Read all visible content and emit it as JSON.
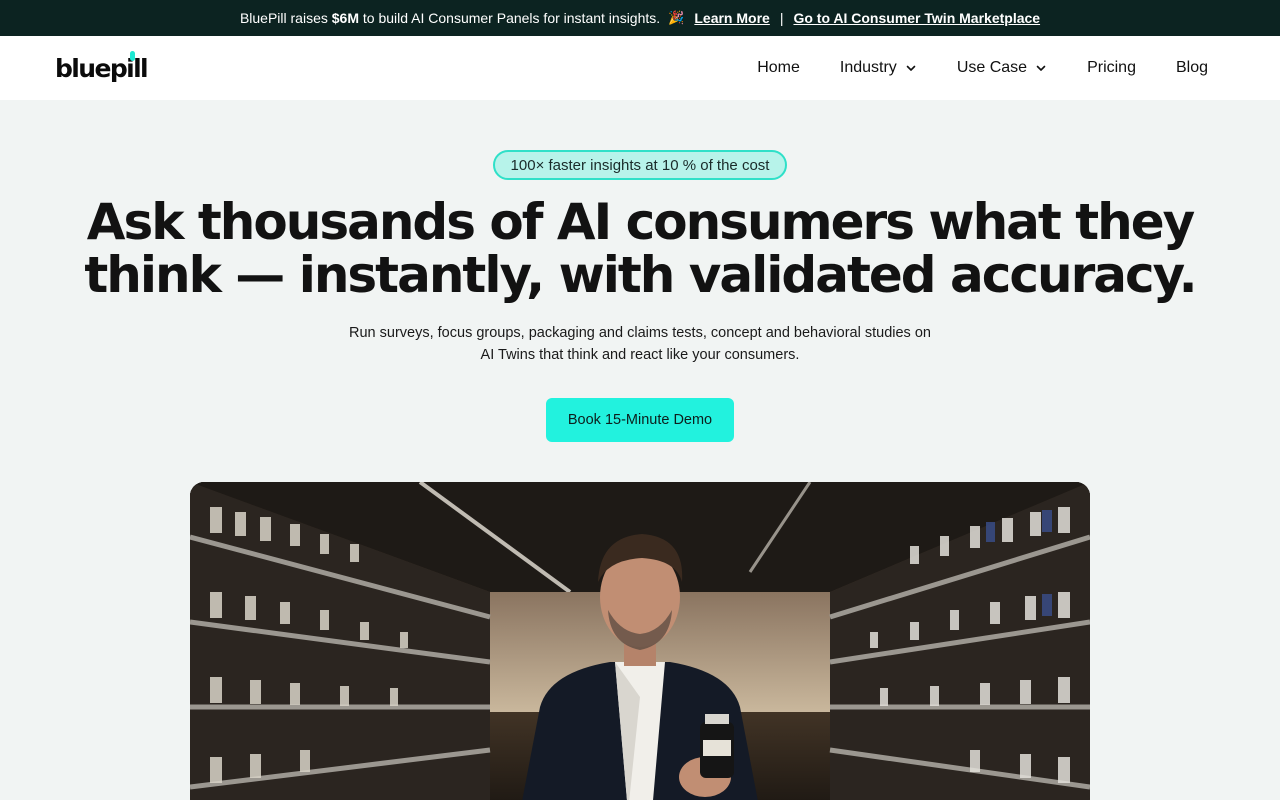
{
  "announcement": {
    "prefix": "BluePill raises ",
    "amount": "$6M",
    "suffix": " to build AI Consumer Panels for instant insights.",
    "emoji": "🎉",
    "learn_more": "Learn More",
    "separator": "|",
    "marketplace_link": "Go to AI Consumer Twin Marketplace"
  },
  "nav": {
    "logo_text": "bluepill",
    "items": [
      {
        "label": "Home",
        "dropdown": false
      },
      {
        "label": "Industry",
        "dropdown": true
      },
      {
        "label": "Use Case",
        "dropdown": true
      },
      {
        "label": "Pricing",
        "dropdown": false
      },
      {
        "label": "Blog",
        "dropdown": false
      }
    ]
  },
  "hero": {
    "badge": "100× faster insights at 10 % of the cost",
    "headline_line1": "Ask thousands of AI consumers what they",
    "headline_line2": "think — instantly, with validated accuracy.",
    "sub_line1": "Run surveys, focus groups, packaging and claims tests, concept and behavioral studies on",
    "sub_line2": "AI Twins that think and react like your consumers.",
    "cta": "Book 15-Minute Demo"
  },
  "colors": {
    "topbar_bg": "#0c2321",
    "accent": "#22f2de",
    "badge_bg": "#b7f3ea",
    "page_bg": "#f1f4f3"
  },
  "icons": {
    "dropdown": "chevron-down-icon",
    "celebration": "party-popper-icon"
  }
}
